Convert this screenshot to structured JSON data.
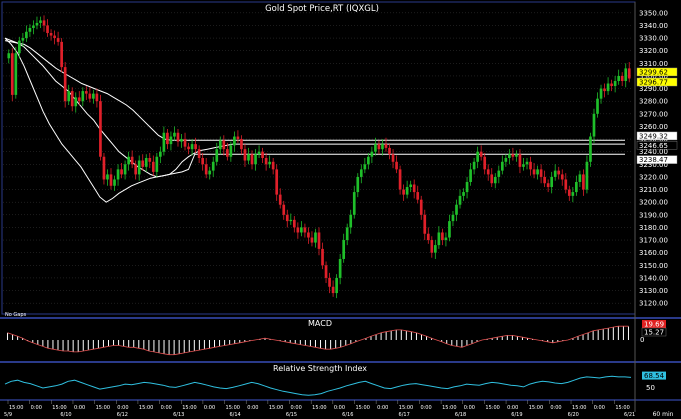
{
  "window": {
    "title": "Gold  Spot  Price,RT  (IQXGL)",
    "footer_interval": "60  min",
    "no_gaps_label": "No Gaps"
  },
  "colors": {
    "background": "#000000",
    "up_candle": "#1fbf2a",
    "down_candle": "#e0202a",
    "moving_average": "#ffffff",
    "macd_line": "#e05050",
    "macd_histogram": "#ffffff",
    "rsi_line": "#30c0e0",
    "panel_border": "#2a3a8a",
    "grid": "#3a3a3a",
    "axis_text": "#ffffff",
    "badge_last": "#ffff00",
    "badge_ma": "#ffffff",
    "badge_macd": "#e02020",
    "badge_rsi": "#30c0e0"
  },
  "chart_data": [
    {
      "type": "candlestick",
      "title": "Gold  Spot  Price,RT  (IQXGL)",
      "ylim": [
        3113,
        3357
      ],
      "y_ticks": [
        "3350.00",
        "3340.00",
        "3330.00",
        "3320.00",
        "3310.00",
        "3300.00",
        "3290.00",
        "3280.00",
        "3270.00",
        "3260.00",
        "3250.00",
        "3240.00",
        "3230.00",
        "3220.00",
        "3210.00",
        "3200.00",
        "3190.00",
        "3180.00",
        "3170.00",
        "3160.00",
        "3150.00",
        "3140.00",
        "3130.00",
        "3120.00"
      ],
      "price_labels": {
        "last": "3296.77",
        "ma_1": "3249.32",
        "ma_2": "3246.65",
        "ma_3": "3238.47",
        "ma_top": "3299.62"
      },
      "closes": [
        3318,
        3285,
        3318,
        3328,
        3330,
        3335,
        3338,
        3340,
        3342,
        3344,
        3340,
        3334,
        3332,
        3330,
        3327,
        3307,
        3280,
        3288,
        3276,
        3283,
        3280,
        3288,
        3286,
        3282,
        3286,
        3280,
        3236,
        3218,
        3222,
        3213,
        3218,
        3226,
        3222,
        3230,
        3236,
        3230,
        3222,
        3233,
        3228,
        3235,
        3232,
        3224,
        3236,
        3240,
        3255,
        3246,
        3252,
        3255,
        3248,
        3250,
        3244,
        3242,
        3246,
        3242,
        3235,
        3230,
        3222,
        3225,
        3232,
        3242,
        3249,
        3242,
        3236,
        3245,
        3252,
        3250,
        3242,
        3233,
        3238,
        3230,
        3238,
        3240,
        3235,
        3230,
        3232,
        3226,
        3206,
        3198,
        3190,
        3185,
        3186,
        3180,
        3176,
        3180,
        3176,
        3172,
        3168,
        3176,
        3163,
        3150,
        3140,
        3133,
        3128,
        3140,
        3155,
        3170,
        3180,
        3190,
        3208,
        3220,
        3226,
        3230,
        3236,
        3240,
        3246,
        3242,
        3246,
        3243,
        3238,
        3232,
        3226,
        3210,
        3206,
        3212,
        3214,
        3208,
        3202,
        3190,
        3175,
        3170,
        3160,
        3166,
        3176,
        3170,
        3172,
        3185,
        3190,
        3198,
        3205,
        3208,
        3216,
        3226,
        3232,
        3240,
        3236,
        3226,
        3222,
        3215,
        3220,
        3225,
        3232,
        3235,
        3238,
        3236,
        3238,
        3228,
        3230,
        3232,
        3226,
        3222,
        3226,
        3220,
        3215,
        3212,
        3220,
        3225,
        3222,
        3218,
        3210,
        3205,
        3208,
        3216,
        3222,
        3210,
        3232,
        3252,
        3270,
        3282,
        3290,
        3288,
        3294,
        3292,
        3296,
        3300,
        3296,
        3306,
        3298
      ],
      "moving_averages": [
        {
          "values": [
            3328,
            3327,
            3326,
            3325,
            3322,
            3318,
            3314,
            3310,
            3306,
            3303,
            3300,
            3297,
            3294,
            3292,
            3290,
            3288,
            3286,
            3283,
            3280,
            3277,
            3273,
            3268,
            3263,
            3258,
            3253,
            3250,
            3249,
            3249,
            3249,
            3249,
            3249,
            3249,
            3249,
            3249,
            3249,
            3249,
            3249,
            3249,
            3249,
            3249,
            3249,
            3249,
            3249,
            3249,
            3249,
            3249,
            3249,
            3249,
            3249,
            3249,
            3249,
            3249,
            3249,
            3249,
            3249,
            3249,
            3249,
            3249,
            3249,
            3249,
            3249,
            3249,
            3249,
            3249,
            3249,
            3249,
            3249,
            3249,
            3249,
            3249,
            3249,
            3249,
            3249,
            3249,
            3249,
            3249,
            3249,
            3249,
            3249,
            3249,
            3249,
            3249,
            3249,
            3249,
            3249,
            3249,
            3249,
            3249,
            3249,
            3249,
            3249,
            3249,
            3249,
            3249,
            3249,
            3249,
            3249,
            3249
          ]
        },
        {
          "values": [
            3330,
            3328,
            3326,
            3323,
            3318,
            3313,
            3308,
            3302,
            3296,
            3292,
            3288,
            3282,
            3276,
            3270,
            3265,
            3258,
            3252,
            3246,
            3240,
            3236,
            3232,
            3228,
            3225,
            3222,
            3220,
            3221,
            3222,
            3226,
            3232,
            3236,
            3239,
            3241,
            3242,
            3243,
            3244,
            3245,
            3246,
            3246,
            3246,
            3246,
            3246,
            3246,
            3246,
            3246,
            3246,
            3246,
            3246,
            3246,
            3246,
            3246,
            3246,
            3246,
            3246,
            3246,
            3246,
            3246,
            3246,
            3246,
            3246,
            3246,
            3246,
            3246,
            3246,
            3246,
            3246,
            3246,
            3246,
            3246,
            3246,
            3246,
            3246,
            3246,
            3246,
            3246,
            3246,
            3246,
            3246,
            3246,
            3246,
            3246,
            3246,
            3246,
            3246,
            3246,
            3246,
            3246,
            3246,
            3246,
            3246,
            3246,
            3246,
            3246,
            3246,
            3246,
            3246,
            3246,
            3246,
            3246,
            3246
          ]
        },
        {
          "values": [
            3330,
            3325,
            3318,
            3308,
            3296,
            3284,
            3272,
            3262,
            3254,
            3246,
            3240,
            3234,
            3228,
            3220,
            3212,
            3204,
            3200,
            3203,
            3207,
            3210,
            3213,
            3215,
            3217,
            3219,
            3220,
            3221,
            3222,
            3223,
            3224,
            3226,
            3238,
            3238,
            3238,
            3238,
            3238,
            3238,
            3238,
            3238,
            3238,
            3238,
            3238,
            3238,
            3238,
            3238,
            3238,
            3238,
            3238,
            3238,
            3238,
            3238,
            3238,
            3238,
            3238,
            3238,
            3238,
            3238,
            3238,
            3238,
            3238,
            3238,
            3238,
            3238,
            3238,
            3238,
            3238,
            3238,
            3238,
            3238,
            3238,
            3238,
            3238,
            3238,
            3238,
            3238,
            3238,
            3238,
            3238,
            3238,
            3238,
            3238,
            3238,
            3238,
            3238,
            3238,
            3238,
            3238,
            3238,
            3238,
            3238,
            3238,
            3238,
            3238,
            3238,
            3238,
            3238,
            3238,
            3238,
            3238,
            3238
          ]
        }
      ]
    },
    {
      "type": "bar",
      "title": "MACD",
      "y_ticks": [
        "0"
      ],
      "latest_label": "15.27",
      "latest_label_prev": "19.69",
      "values": [
        8,
        6,
        4,
        2,
        -1,
        -3,
        -5,
        -7,
        -9,
        -10,
        -11,
        -12,
        -12,
        -13,
        -13,
        -12,
        -11,
        -10,
        -9,
        -8,
        -7,
        -6,
        -6,
        -7,
        -8,
        -8,
        -9,
        -10,
        -12,
        -13,
        -14,
        -15,
        -16,
        -16,
        -15,
        -14,
        -13,
        -12,
        -11,
        -10,
        -9,
        -8,
        -7,
        -6,
        -5,
        -4,
        -3,
        -2,
        -1,
        0,
        1,
        2,
        1,
        0,
        -1,
        -2,
        -3,
        -4,
        -5,
        -6,
        -7,
        -8,
        -9,
        -10,
        -10,
        -9,
        -8,
        -6,
        -4,
        -2,
        0,
        2,
        4,
        6,
        8,
        9,
        10,
        11,
        11,
        10,
        9,
        8,
        6,
        4,
        2,
        0,
        -2,
        -4,
        -6,
        -7,
        -8,
        -6,
        -4,
        -2,
        0,
        1,
        2,
        3,
        4,
        5,
        5,
        4,
        3,
        2,
        1,
        0,
        -1,
        -2,
        -3,
        -2,
        -1,
        0,
        2,
        4,
        6,
        8,
        10,
        11,
        12,
        13,
        14,
        15,
        15,
        15
      ]
    },
    {
      "type": "line",
      "title": "Relative  Strength  Index",
      "y_ticks": [
        "50"
      ],
      "latest_label": "68.54",
      "values": [
        55,
        60,
        62,
        58,
        56,
        52,
        48,
        50,
        52,
        55,
        60,
        62,
        58,
        54,
        50,
        46,
        48,
        50,
        52,
        55,
        54,
        56,
        58,
        57,
        55,
        53,
        50,
        49,
        52,
        55,
        58,
        56,
        53,
        50,
        48,
        47,
        49,
        52,
        55,
        58,
        56,
        52,
        48,
        45,
        42,
        40,
        38,
        36,
        35,
        36,
        38,
        42,
        45,
        48,
        52,
        55,
        58,
        60,
        56,
        52,
        48,
        47,
        50,
        53,
        55,
        56,
        54,
        52,
        50,
        48,
        47,
        50,
        52,
        55,
        54,
        53,
        56,
        58,
        57,
        55,
        53,
        52,
        50,
        55,
        58,
        60,
        59,
        57,
        56,
        58,
        62,
        66,
        68,
        67,
        66,
        68,
        69,
        68,
        68,
        67
      ]
    }
  ],
  "x_axis": {
    "time_labels": [
      "15:00",
      "0:00",
      "15:00",
      "0:00",
      "15:00",
      "0:00",
      "15:00",
      "0:00",
      "15:00",
      "0:00",
      "15:00",
      "0:00",
      "15:00",
      "0:00",
      "15:00",
      "0:00",
      "15:00",
      "0:00",
      "15:00",
      "0:00",
      "15:00",
      "0:00",
      "15:00",
      "0:00",
      "15:00",
      "0:00",
      "15:00",
      "0:00",
      "15:00"
    ],
    "date_labels": [
      "5/9",
      "6/10",
      "6/12",
      "6/13",
      "6/14",
      "6/15",
      "6/16",
      "6/17",
      "6/18",
      "6/19",
      "6/20",
      "6/21"
    ]
  }
}
